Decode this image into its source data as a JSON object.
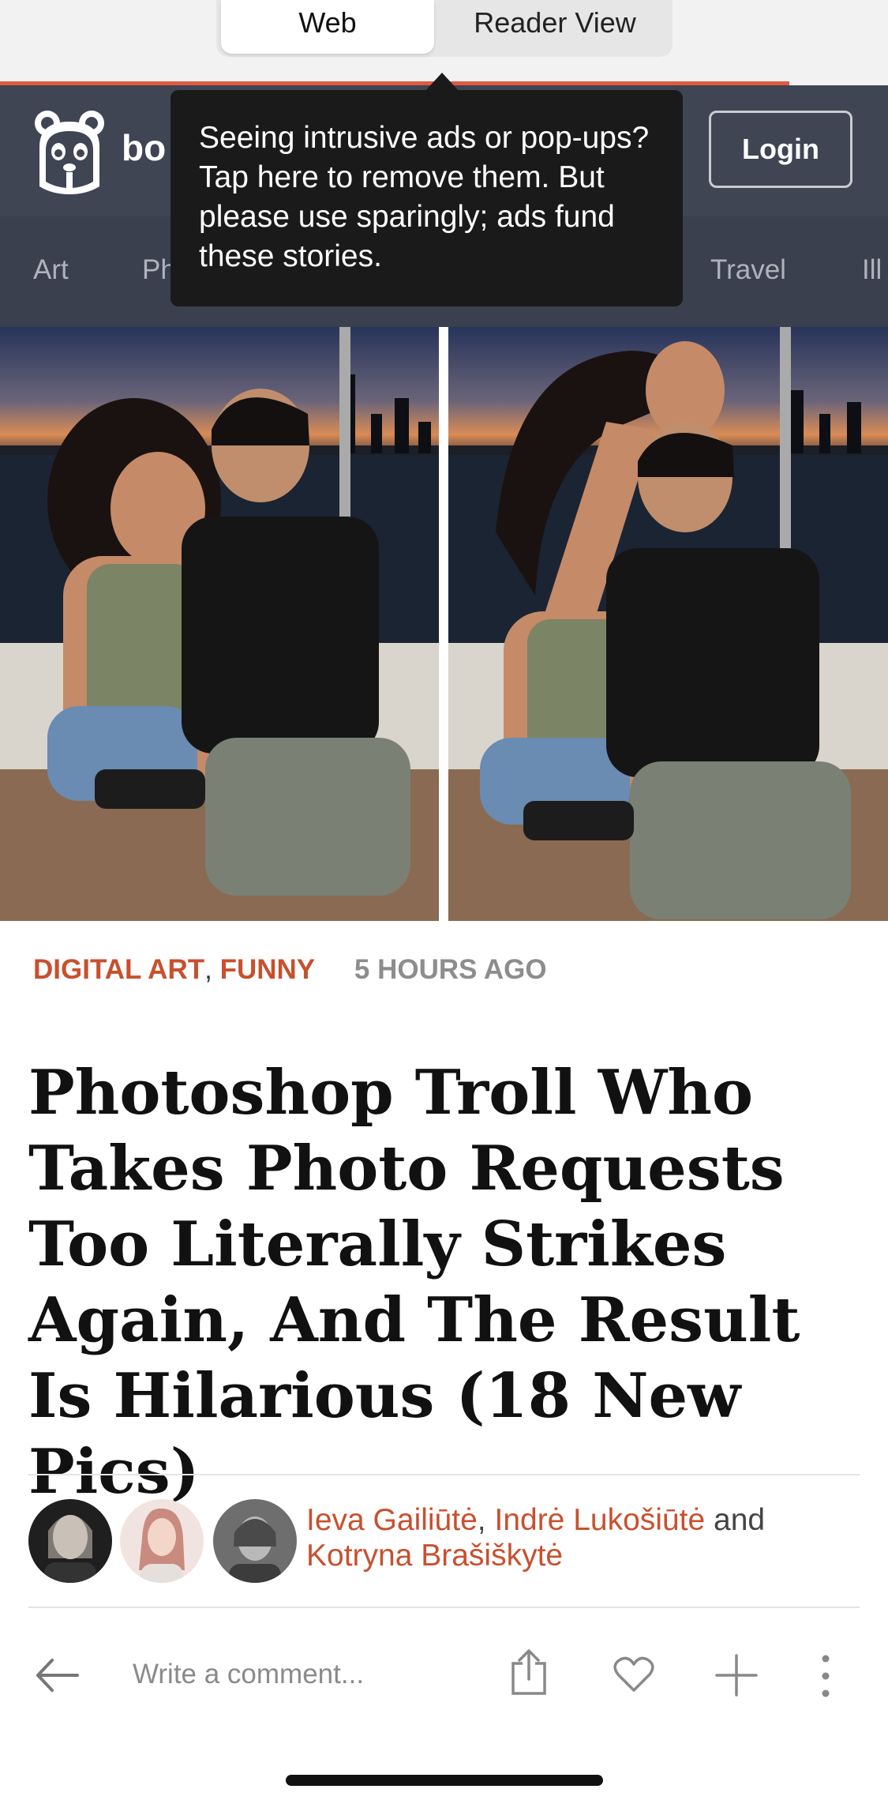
{
  "segmented": {
    "web": "Web",
    "reader": "Reader View"
  },
  "site": {
    "logo_text": "bo",
    "login": "Login",
    "nav": [
      "Art",
      "Ph",
      "Travel",
      "Ill"
    ]
  },
  "tooltip": {
    "text": "Seeing intrusive ads or pop-ups? Tap here to remove them. But please use sparingly; ads fund these stories."
  },
  "article": {
    "categories": [
      "DIGITAL ART",
      "FUNNY"
    ],
    "separator": ",",
    "time": "5 HOURS AGO",
    "title": "Photoshop Troll Who Takes Photo Requests Too Literally Strikes Again, And The Result Is Hilarious (18 New Pics)",
    "authors": [
      "Ieva Gailiūtė",
      "Indrė Lukošiūtė",
      "Kotryna Brašiškytė"
    ],
    "authors_sep": ",",
    "authors_and": "and"
  },
  "actions": {
    "comment_placeholder": "Write a comment..."
  },
  "colors": {
    "accent": "#c8502e",
    "header": "#3f4553",
    "progress": "#e05a3f"
  }
}
